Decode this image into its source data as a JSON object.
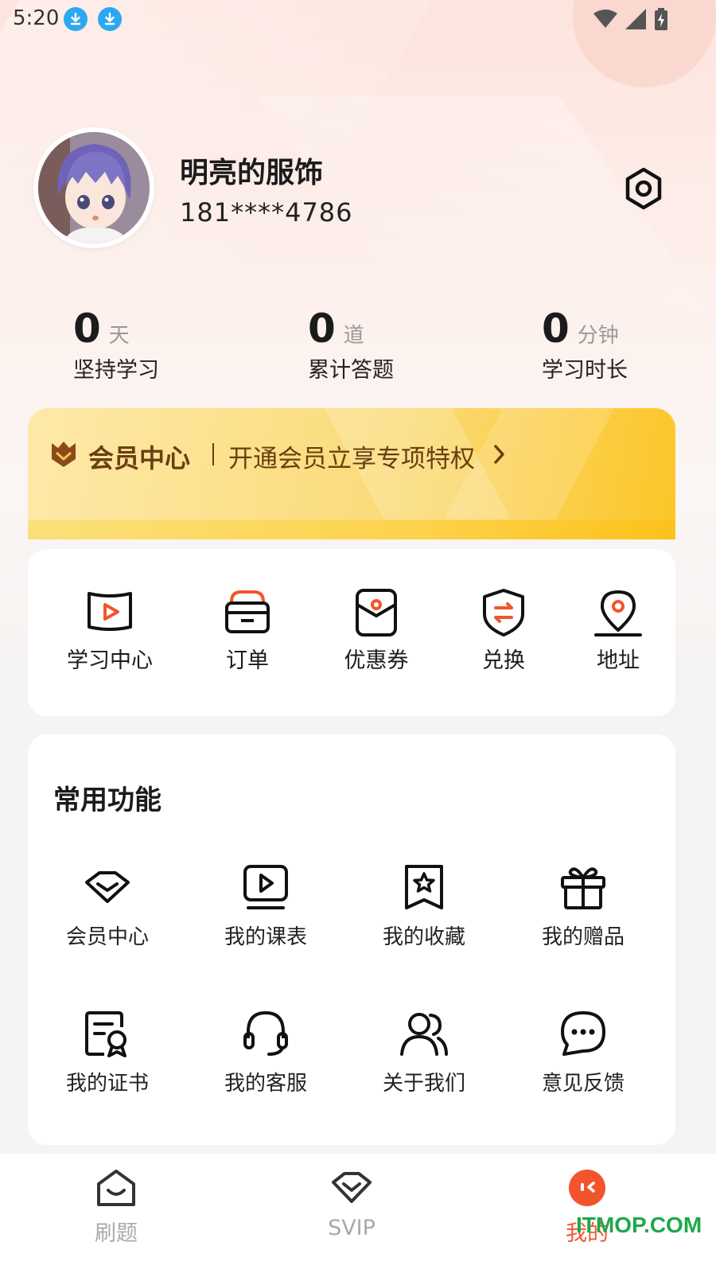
{
  "status_bar": {
    "time": "5:20"
  },
  "profile": {
    "name": "明亮的服饰",
    "phone": "181****4786"
  },
  "stats": [
    {
      "value": "0",
      "unit": "天",
      "label": "坚持学习"
    },
    {
      "value": "0",
      "unit": "道",
      "label": "累计答题"
    },
    {
      "value": "0",
      "unit": "分钟",
      "label": "学习时长"
    }
  ],
  "vip_banner": {
    "title": "会员中心",
    "description": "开通会员立享专项特权"
  },
  "quick_menu": [
    {
      "label": "学习中心",
      "icon": "study-center-icon"
    },
    {
      "label": "订单",
      "icon": "order-icon"
    },
    {
      "label": "优惠券",
      "icon": "coupon-icon"
    },
    {
      "label": "兑换",
      "icon": "exchange-icon"
    },
    {
      "label": "地址",
      "icon": "address-icon"
    }
  ],
  "common_functions": {
    "title": "常用功能",
    "items": [
      {
        "label": "会员中心",
        "icon": "diamond-icon"
      },
      {
        "label": "我的课表",
        "icon": "video-play-icon"
      },
      {
        "label": "我的收藏",
        "icon": "bookmark-star-icon"
      },
      {
        "label": "我的赠品",
        "icon": "gift-icon"
      },
      {
        "label": "我的证书",
        "icon": "certificate-icon"
      },
      {
        "label": "我的客服",
        "icon": "headset-icon"
      },
      {
        "label": "关于我们",
        "icon": "users-icon"
      },
      {
        "label": "意见反馈",
        "icon": "chat-bubble-icon"
      }
    ]
  },
  "tab_bar": [
    {
      "label": "刷题",
      "icon": "home-icon",
      "active": false
    },
    {
      "label": "SVIP",
      "icon": "diamond-icon",
      "active": false
    },
    {
      "label": "我的",
      "icon": "profile-icon",
      "active": true
    }
  ],
  "watermark": "ITMOP.COM",
  "colors": {
    "accent": "#f2552c",
    "vip_text": "#6b3e10",
    "vip_gold": "#fcc628",
    "download_blue": "#2da8f0"
  }
}
